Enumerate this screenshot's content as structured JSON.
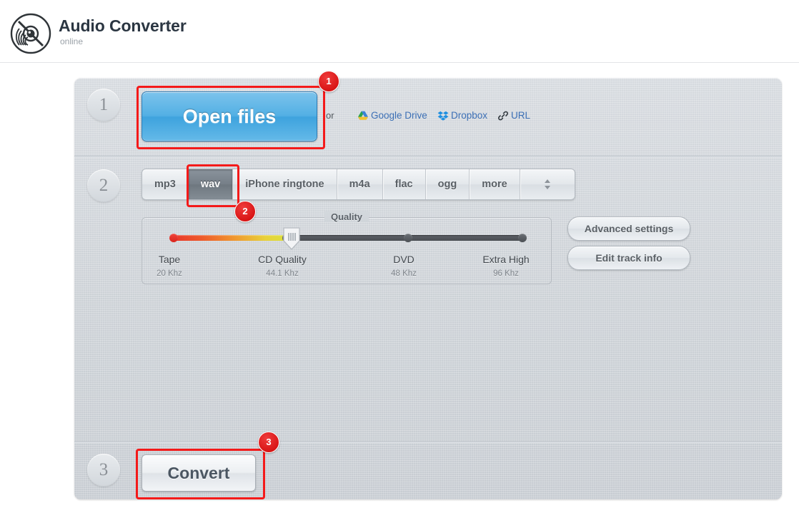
{
  "header": {
    "logo_icon": "vinyl-record-icon",
    "title": "Audio Converter",
    "subtitle": "online"
  },
  "panel": {
    "steps": [
      {
        "number": "1"
      },
      {
        "number": "2"
      },
      {
        "number": "3"
      }
    ]
  },
  "step1": {
    "open_files_label": "Open files",
    "or_text": "or",
    "cloud_links": [
      {
        "icon": "google-drive-icon",
        "label": "Google Drive"
      },
      {
        "icon": "dropbox-icon",
        "label": "Dropbox"
      },
      {
        "icon": "link-icon",
        "label": "URL"
      }
    ]
  },
  "step2": {
    "format_tabs": [
      {
        "label": "mp3",
        "selected": false
      },
      {
        "label": "wav",
        "selected": true
      },
      {
        "label": "iPhone ringtone",
        "selected": false
      },
      {
        "label": "m4a",
        "selected": false
      },
      {
        "label": "flac",
        "selected": false
      },
      {
        "label": "ogg",
        "selected": false
      },
      {
        "label": "more",
        "selected": false
      }
    ],
    "stepper_icon": "up-down-stepper-icon",
    "quality": {
      "legend": "Quality",
      "selected_index": 1,
      "marks": [
        {
          "label": "Tape",
          "rate": "20 Khz"
        },
        {
          "label": "CD Quality",
          "rate": "44.1 Khz"
        },
        {
          "label": "DVD",
          "rate": "48 Khz"
        },
        {
          "label": "Extra High",
          "rate": "96 Khz"
        }
      ]
    },
    "side_buttons": [
      {
        "label": "Advanced settings"
      },
      {
        "label": "Edit track info"
      }
    ]
  },
  "step3": {
    "convert_label": "Convert"
  },
  "annotations": [
    {
      "badge": "1"
    },
    {
      "badge": "2"
    },
    {
      "badge": "3"
    }
  ],
  "colors": {
    "accent_blue": "#53b0e4",
    "annotation_red": "#f41a1a",
    "link_blue": "#3b6fb5",
    "panel_gray": "#ced3d8"
  }
}
